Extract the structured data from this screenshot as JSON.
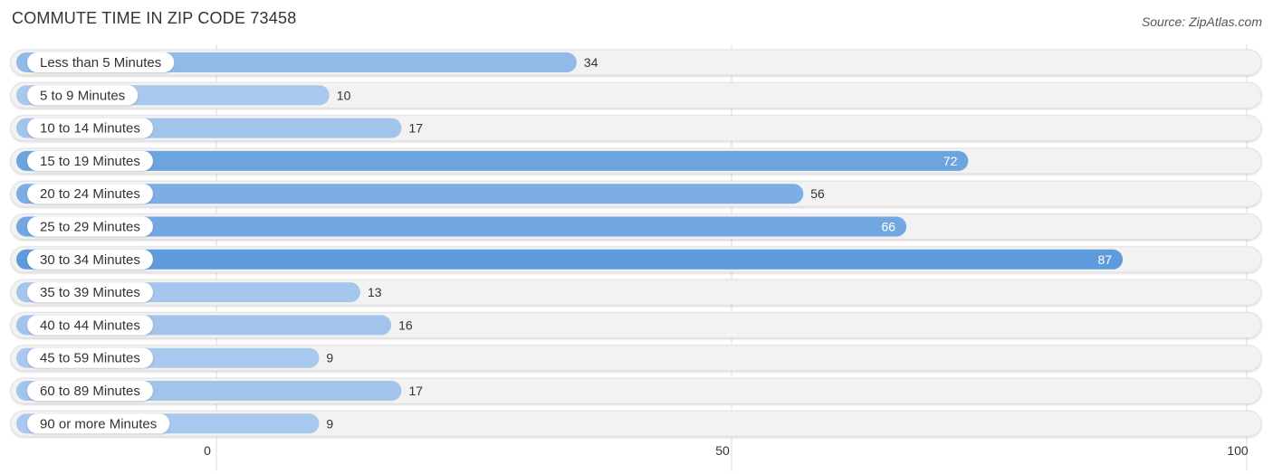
{
  "header": {
    "title": "COMMUTE TIME IN ZIP CODE 73458",
    "source": "Source: ZipAtlas.com"
  },
  "colors": {
    "bar_light": "#aac9ed",
    "bar_dark": "#5e9bdc",
    "track": "#f2f2f2",
    "grid": "#dddddd",
    "label_bg": "#ffffff",
    "text": "#333333",
    "value_inside": "#ffffff"
  },
  "chart_data": {
    "type": "bar",
    "orientation": "horizontal",
    "title": "COMMUTE TIME IN ZIP CODE 73458",
    "xlabel": "",
    "ylabel": "",
    "categories": [
      "Less than 5 Minutes",
      "5 to 9 Minutes",
      "10 to 14 Minutes",
      "15 to 19 Minutes",
      "20 to 24 Minutes",
      "25 to 29 Minutes",
      "30 to 34 Minutes",
      "35 to 39 Minutes",
      "40 to 44 Minutes",
      "45 to 59 Minutes",
      "60 to 89 Minutes",
      "90 or more Minutes"
    ],
    "values": [
      34,
      10,
      17,
      72,
      56,
      66,
      87,
      13,
      16,
      9,
      17,
      9
    ],
    "xlim": [
      0,
      100
    ],
    "xticks": [
      0,
      50,
      100
    ],
    "xtick_labels": [
      "0",
      "50",
      "100"
    ],
    "grid": true,
    "legend": "none"
  }
}
